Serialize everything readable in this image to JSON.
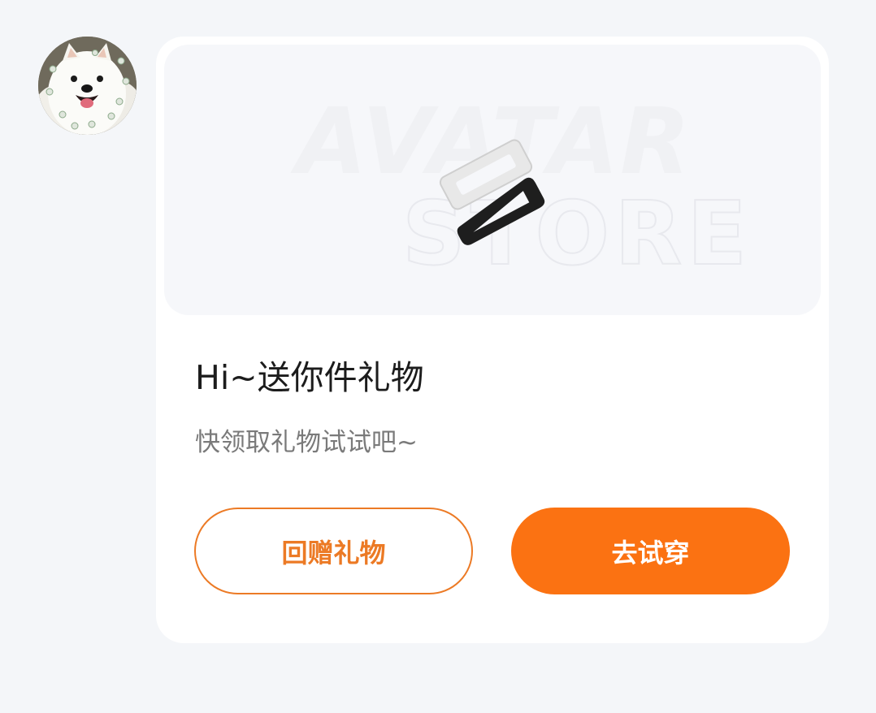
{
  "sender": {
    "avatar_icon": "samoyed-dog-avatar-icon"
  },
  "gift_card": {
    "banner": {
      "watermark_line1": "AVATAR",
      "watermark_line2": "STORE",
      "item_icon": "hair-clip-pair-icon"
    },
    "title": "Hi~送你件礼物",
    "subtitle": "快领取礼物试试吧~",
    "return_gift_label": "回赠礼物",
    "try_on_label": "去试穿"
  },
  "colors": {
    "page_background": "#f4f6f9",
    "card_background": "#ffffff",
    "banner_background": "#f6f7fa",
    "accent_orange": "#fb7212",
    "outline_orange": "#ec7a25",
    "title_text": "#1c1c1c",
    "subtitle_text": "#7a7a7a"
  }
}
